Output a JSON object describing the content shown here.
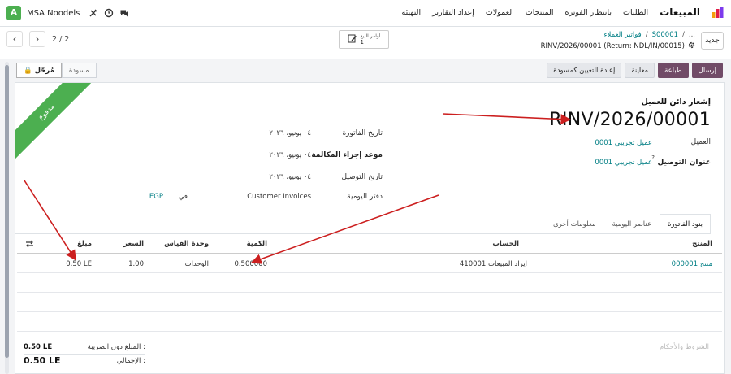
{
  "navbar": {
    "app_name": "المبيعات",
    "menu": [
      "الطلبات",
      "بانتظار الفوترة",
      "المنتجات",
      "العمولات",
      "إعداد التقارير",
      "التهيئة"
    ],
    "company": "MSA Noodels",
    "avatar_letter": "A",
    "icons": [
      "chat-icon",
      "clock-icon",
      "tools-icon"
    ]
  },
  "control_panel": {
    "new_button": "جديد",
    "breadcrumb_sep": "/",
    "breadcrumb_order": "S00001",
    "breadcrumb_more": "...",
    "breadcrumb_invoices": "فواتير العملاء",
    "record_title": "RINV/2026/00001 (Return: NDL/IN/00015)",
    "pager_value": "2 / 2",
    "smart_button_label": "أوامر البيع",
    "smart_button_count": "1"
  },
  "actions": {
    "send": "إرسال",
    "print": "طباعة",
    "preview": "معاينة",
    "reset_to_draft": "إعادة التعيين كمسودة",
    "status_posted": "مُرحّل",
    "status_draft": "مسودة"
  },
  "document": {
    "ribbon": "مدفوع",
    "type": "إشعار دائن للعميل",
    "name": "RINV/2026/00001"
  },
  "fields": {
    "customer_label": "العميل",
    "customer_value": "عميل تجريبي 0001",
    "delivery_label": "عنوان التوصيل",
    "delivery_help": "?",
    "delivery_value": "عميل تجريبي 0001",
    "invoice_date_label": "تاريخ الفاتورة",
    "invoice_date_value": "٠٤ يونيو، ٢٠٢٦",
    "due_date_label": "موعد إجراء المكالمة",
    "due_date_value": "٠٤ يونيو، ٢٠٢٦",
    "delivery_date_label": "تاريخ التوصيل",
    "delivery_date_value": "٠٤ يونيو، ٢٠٢٦",
    "journal_label": "دفتر اليومية",
    "journal_value": "Customer Invoices",
    "currency_in": "في",
    "currency_value": "EGP"
  },
  "tabs": [
    "بنود الفاتورة",
    "عناصر اليومية",
    "معلومات أخرى"
  ],
  "table": {
    "headers": {
      "product": "المنتج",
      "account": "الحساب",
      "quantity": "الكمية",
      "uom": "وحدة القياس",
      "price": "السعر",
      "amount": "مبلغ"
    },
    "rows": [
      {
        "product": "منتج 000001",
        "account": "410001 ايراد المبيعات",
        "quantity": "0.500000",
        "uom": "الوحدات",
        "price": "1.00",
        "amount": "0.50 LE"
      }
    ]
  },
  "footer": {
    "terms_placeholder": "الشروط والأحكام",
    "untaxed_label": "المبلغ دون الضريبة :",
    "untaxed_value": "0.50 LE",
    "total_label": "الإجمالي :",
    "total_value": "0.50 LE"
  },
  "colors": {
    "primary": "#714b67",
    "ribbon": "#4caf50",
    "link": "#017e84",
    "annotation_arrow": "#cc1f1f"
  }
}
